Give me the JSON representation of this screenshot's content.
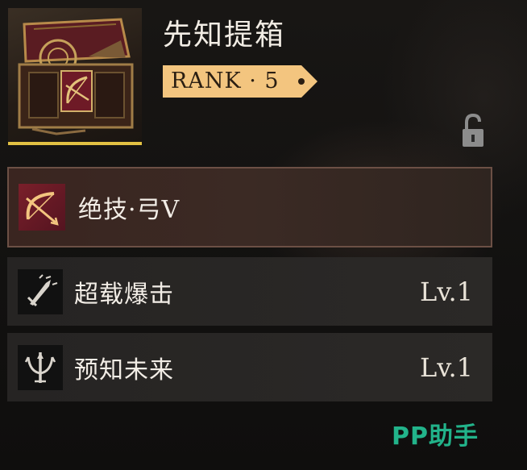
{
  "item": {
    "title": "先知提箱",
    "rank_label": "RANK · 5",
    "rank_value": 5,
    "image_icon": "treasure-chest-with-bow-emblem",
    "lock_icon": "unlocked-padlock-icon"
  },
  "skills": [
    {
      "name": "绝技·弓V",
      "level": "",
      "icon": "bow-arrow-icon",
      "selected": true
    },
    {
      "name": "超载爆击",
      "level": "Lv.1",
      "icon": "sword-burst-icon",
      "selected": false
    },
    {
      "name": "预知未来",
      "level": "Lv.1",
      "icon": "trident-icon",
      "selected": false
    }
  ],
  "watermark": "PP助手",
  "colors": {
    "rank_tag": "#f3c57f",
    "accent_border": "#e2c143",
    "selected_row": "#3a2520",
    "watermark": "#22b38a"
  }
}
